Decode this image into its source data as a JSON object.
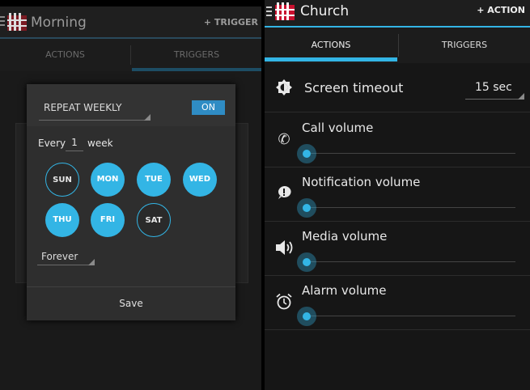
{
  "left": {
    "title": "Morning",
    "trigger_button": "+ TRIGGER",
    "tabs": [
      "ACTIONS",
      "TRIGGERS"
    ],
    "dialog": {
      "repeat_label": "REPEAT WEEKLY",
      "toggle_label": "ON",
      "every_label": "Every",
      "every_value": "1",
      "week_label": "week",
      "days": [
        {
          "label": "SUN",
          "selected": false
        },
        {
          "label": "MON",
          "selected": true
        },
        {
          "label": "TUE",
          "selected": true
        },
        {
          "label": "WED",
          "selected": true
        },
        {
          "label": "THU",
          "selected": true
        },
        {
          "label": "FRI",
          "selected": true
        },
        {
          "label": "SAT",
          "selected": false
        }
      ],
      "duration": "Forever",
      "save_label": "Save"
    }
  },
  "right": {
    "title": "Church",
    "action_button": "+ ACTION",
    "tabs": [
      "ACTIONS",
      "TRIGGERS"
    ],
    "screen_timeout": {
      "label": "Screen timeout",
      "value": "15 sec"
    },
    "volumes": [
      {
        "label": "Call volume",
        "icon": "phone-icon",
        "level": 0
      },
      {
        "label": "Notification volume",
        "icon": "notification-icon",
        "level": 0
      },
      {
        "label": "Media volume",
        "icon": "speaker-icon",
        "level": 0
      },
      {
        "label": "Alarm volume",
        "icon": "alarm-clock-icon",
        "level": 0
      }
    ]
  },
  "colors": {
    "accent": "#33b5e5",
    "toggle_on": "#2f8cc4",
    "logo_red": "#c8102e"
  }
}
